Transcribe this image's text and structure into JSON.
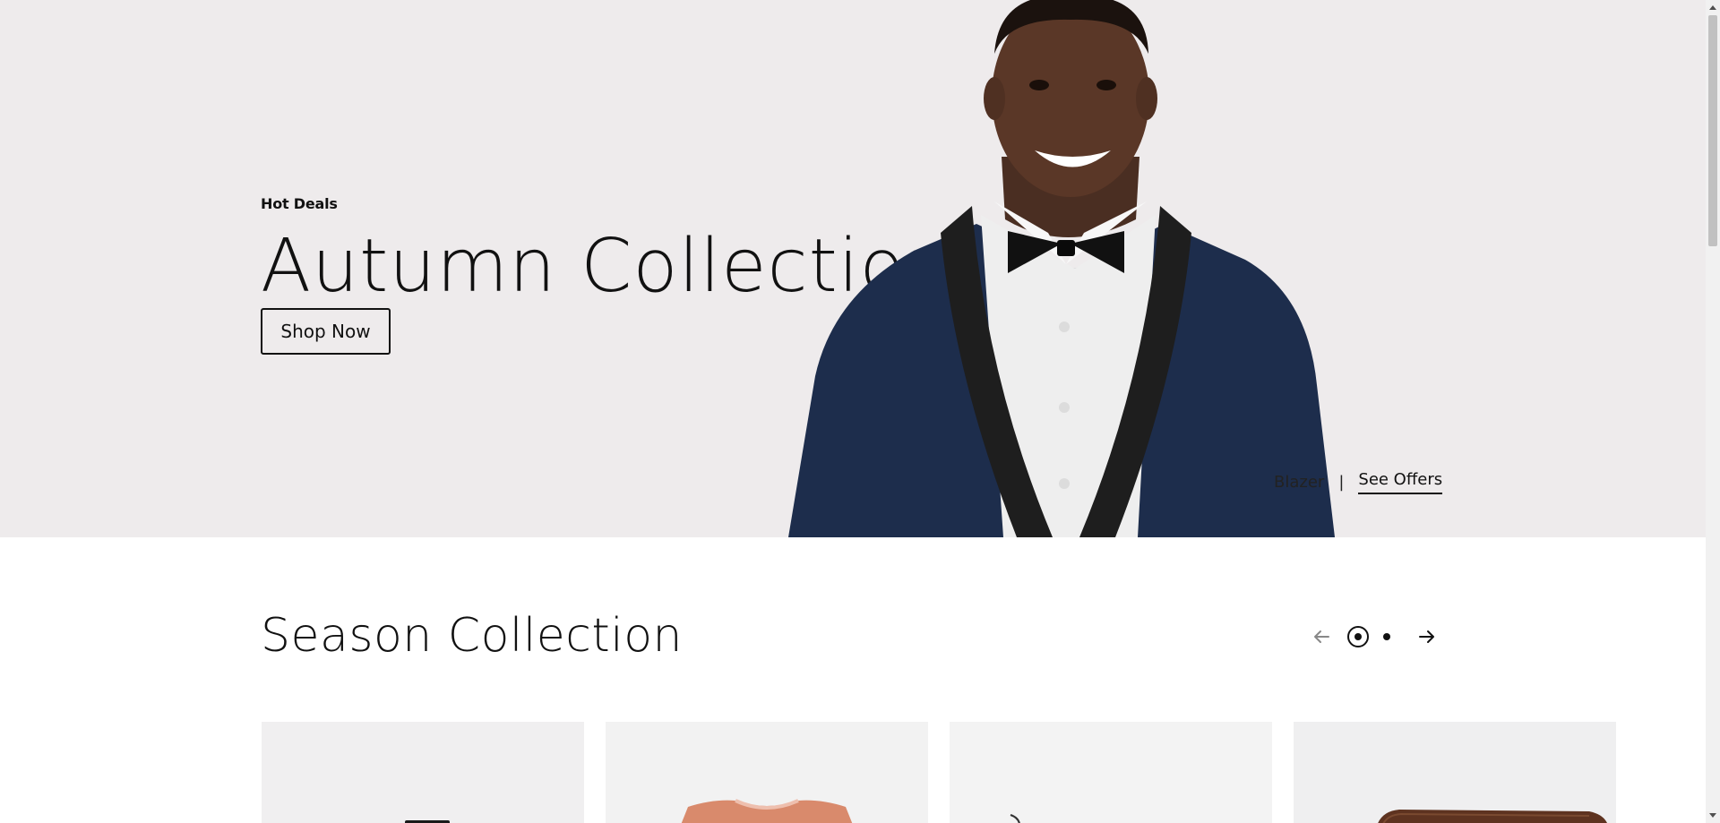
{
  "hero": {
    "eyebrow": "Hot Deals",
    "title": "Autumn Collection",
    "cta_label": "Shop Now",
    "category_link": "Blazer",
    "separator": "|",
    "offers_link": "See Offers",
    "background_color": "#eeebec"
  },
  "season": {
    "title": "Season Collection",
    "slider": {
      "prev_icon": "arrow-left-icon",
      "next_icon": "arrow-right-icon",
      "active_page": 1,
      "page_count": 2
    },
    "products": [
      {
        "image": "product-image-dark-item"
      },
      {
        "image": "product-image-salmon-tshirt"
      },
      {
        "image": "product-image-hanger-item"
      },
      {
        "image": "product-image-brown-leather-bag"
      }
    ]
  }
}
